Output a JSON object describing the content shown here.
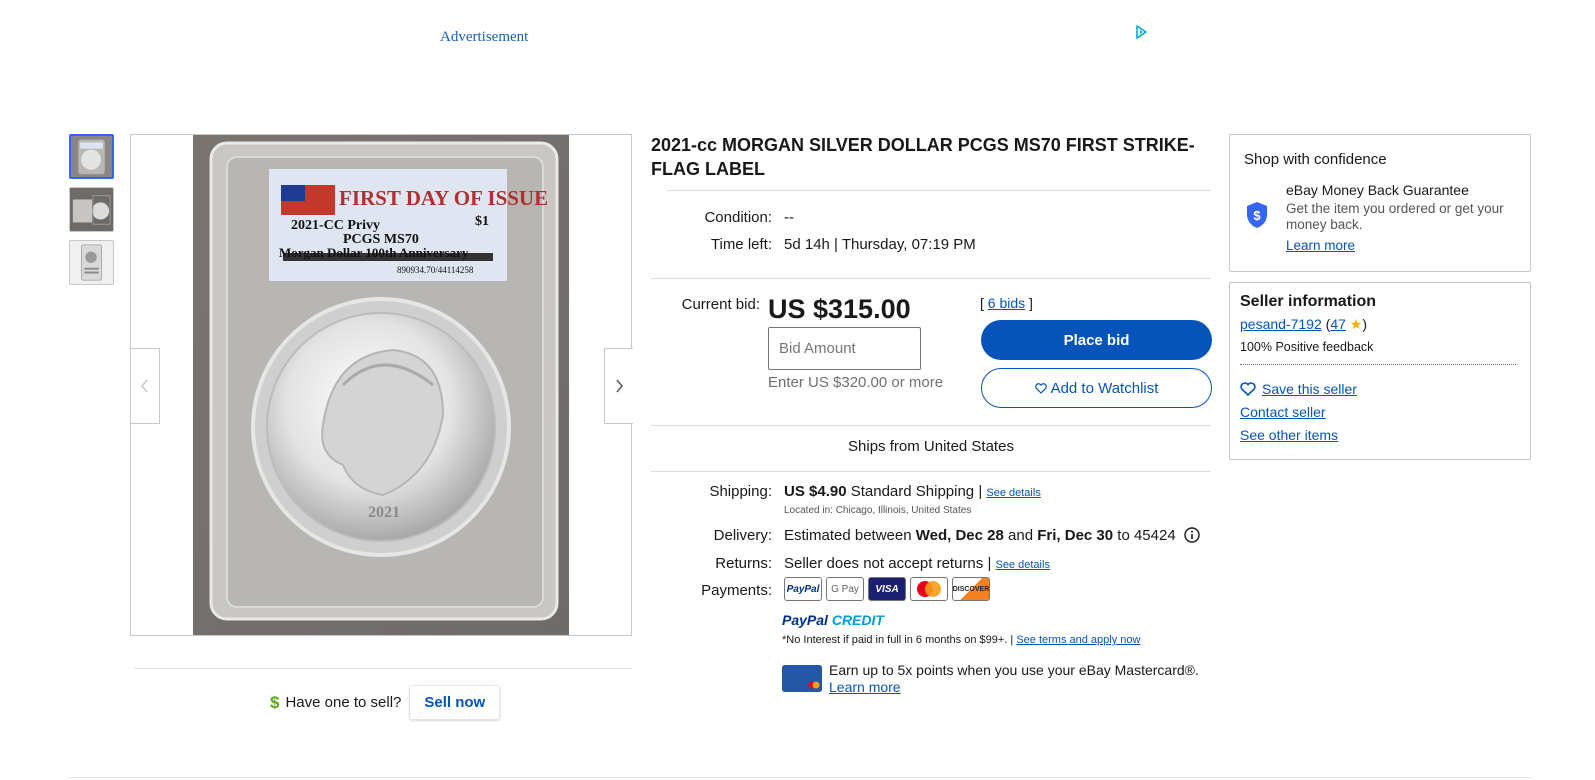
{
  "ad": {
    "label": "Advertisement",
    "icon": "ad-choices-icon"
  },
  "gallery": {
    "thumbnails": [
      "thumb-1",
      "thumb-2",
      "thumb-3"
    ],
    "label_text": {
      "line1": "FIRST DAY OF ISSUE",
      "line2": "2021-CC Privy",
      "line3": "PCGS MS70",
      "line4": "$1",
      "line5": "Morgan Dollar 100th Anniversary",
      "line6": "890934.70/44114258"
    }
  },
  "sell": {
    "question": "Have one to sell?",
    "button": "Sell now"
  },
  "item": {
    "title": "2021-cc MORGAN SILVER DOLLAR PCGS MS70 FIRST STRIKE-FLAG LABEL",
    "condition_label": "Condition:",
    "condition_value": "--",
    "time_left_label": "Time left:",
    "time_left_value": "5d 14h | Thursday, 07:19 PM",
    "current_bid_label": "Current bid:",
    "current_bid_value": "US $315.00",
    "bids_open": "[",
    "bids_link": "6 bids",
    "bids_close": "]",
    "bid_placeholder": "Bid Amount",
    "bid_hint": "Enter US $320.00 or more",
    "place_bid": "Place bid",
    "watchlist": "Add to Watchlist",
    "ships_from": "Ships from United States"
  },
  "shipping": {
    "label": "Shipping:",
    "price": "US $4.90",
    "method": "Standard Shipping |",
    "see_details": "See details",
    "located": "Located in: Chicago, Illinois, United States"
  },
  "delivery": {
    "label": "Delivery:",
    "pre": "Estimated between",
    "from": "Wed, Dec 28",
    "and": "and",
    "to": "Fri, Dec 30",
    "zip": "to 45424"
  },
  "returns": {
    "label": "Returns:",
    "value": "Seller does not accept returns |",
    "see_details": "See details"
  },
  "payments": {
    "label": "Payments:",
    "methods": [
      "PayPal",
      "G Pay",
      "VISA",
      "Mastercard",
      "DISCOVER"
    ],
    "paypal_credit_a": "PayPal",
    "paypal_credit_b": "CREDIT",
    "no_interest": "*No Interest if paid in full in 6 months on $99+. |",
    "terms_link": "See terms and apply now",
    "mastercard_text": "Earn up to 5x points when you use your eBay Mastercard®.",
    "learn_more": "Learn more"
  },
  "confidence": {
    "title": "Shop with confidence",
    "mbg_title": "eBay Money Back Guarantee",
    "mbg_desc": "Get the item you ordered or get your money back.",
    "learn_more": "Learn more"
  },
  "seller": {
    "title": "Seller information",
    "name": "pesand-7192",
    "feedback_count": "47",
    "positive": "100% Positive feedback",
    "save": "Save this seller",
    "contact": "Contact seller",
    "other": "See other items"
  },
  "colors": {
    "link": "#0654ba",
    "primary": "#0654ba",
    "shield": "#3665f3",
    "star": "#f5af02"
  }
}
